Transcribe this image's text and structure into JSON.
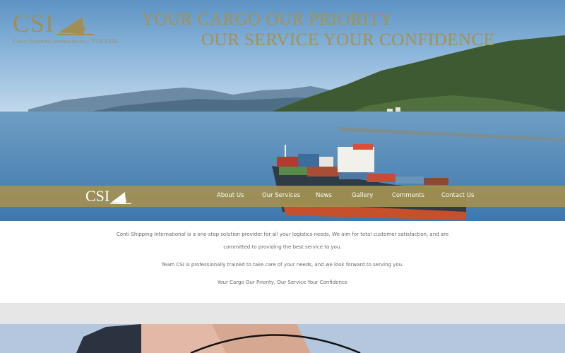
{
  "brand": {
    "letters": "CSI",
    "company_name": "Conti Shipping International PTE LTD.",
    "color": "#a08f55"
  },
  "tagline": {
    "line1": "YOUR CARGO OUR PRIORITY",
    "line2": "OUR SERVICE YOUR CONFIDENCE",
    "color": "#a69150"
  },
  "nav": {
    "logo": "CSI",
    "bar_color": "#a08f52",
    "items": [
      "About Us",
      "Our Services",
      "News",
      "Gallery",
      "Comments",
      "Contact Us"
    ]
  },
  "content": {
    "paragraph1_line1": "Conti Shipping International is a one-stop solution provider for all your logistics needs. We aim for total customer satisfaction, and are",
    "paragraph1_line2": "committed to providing the best service to you.",
    "paragraph2": "Team CSI is professionally trained to take care of your needs, and we look forward to serving you.",
    "paragraph3": "Your Cargo Our Priority, Our Service Your Confidence"
  },
  "icons": {
    "logo_sail": "sail-icon"
  }
}
